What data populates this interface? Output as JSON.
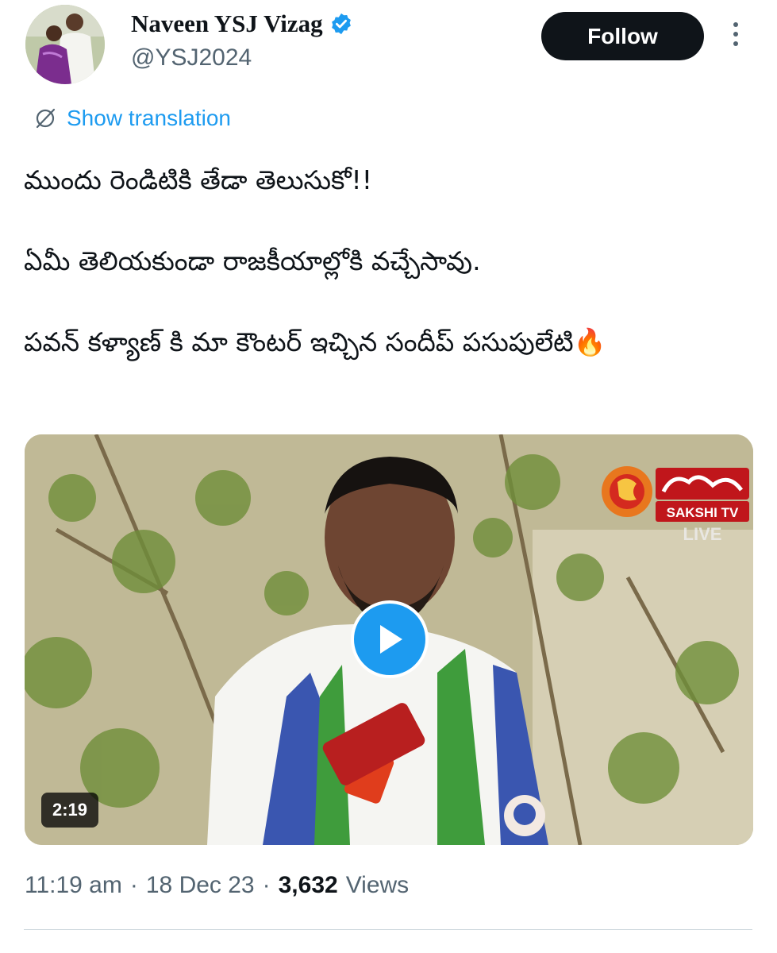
{
  "user": {
    "display_name": "Naveen YSJ Vizag",
    "handle": "@YSJ2024",
    "verified": true
  },
  "actions": {
    "follow_label": "Follow",
    "more_icon": "more-vertical-icon"
  },
  "translation": {
    "label": "Show translation",
    "icon": "globe-slash-icon"
  },
  "tweet": {
    "lines": [
      "ముందు రెండిటికి తేడా తెలుసుకో!!",
      "ఏమీ తెలియకుండా రాజకీయాల్లోకి వచ్చేసావు.",
      "పవన్ కళ్యాణ్ కి మా కౌంటర్ ఇచ్చిన సందీప్ పసుపులేటి🔥"
    ]
  },
  "media": {
    "duration": "2:19",
    "channel_name": "SAKSHI TV",
    "channel_live": "LIVE",
    "play_icon": "play-icon"
  },
  "meta": {
    "time": "11:19 am",
    "date": "18 Dec 23",
    "separator": "·",
    "views_count": "3,632",
    "views_label": "Views"
  },
  "colors": {
    "accent": "#1d9bf0",
    "text_primary": "#0f1419",
    "text_secondary": "#536471",
    "follow_bg": "#0f1419"
  }
}
